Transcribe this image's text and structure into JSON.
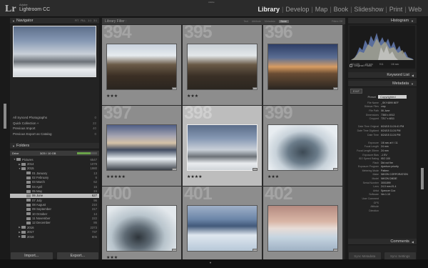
{
  "topbar": {
    "adobe": "Adobe",
    "app_title": "Lightroom CC",
    "logo": "Lr",
    "top_label": "Adobe",
    "modules": [
      "Library",
      "Develop",
      "Map",
      "Book",
      "Slideshow",
      "Print",
      "Web"
    ],
    "active_module": "Library"
  },
  "navigator": {
    "title": "Navigator",
    "options": [
      "FIT",
      "FILL",
      "1:1",
      "3:1"
    ]
  },
  "catalog": [
    {
      "label": "All Synced Photographs",
      "count": "0"
    },
    {
      "label": "Quick Collection +",
      "count": "22"
    },
    {
      "label": "Previous Import",
      "count": "40"
    },
    {
      "label": "Previous Export as Catalog",
      "count": "0"
    }
  ],
  "folders": {
    "title": "Folders",
    "volume": "Drive",
    "volume_info": "3/25 / 10 GB",
    "tree": [
      {
        "name": "Pictures",
        "count": "6547",
        "level": 1,
        "arrow": "▼"
      },
      {
        "name": "2014",
        "count": "1079",
        "level": 2,
        "arrow": "▶"
      },
      {
        "name": "2015",
        "count": "1980",
        "level": 2,
        "arrow": "▼"
      },
      {
        "name": "01 January",
        "count": "13",
        "level": 3,
        "arrow": ""
      },
      {
        "name": "02 February",
        "count": "6",
        "level": 3,
        "arrow": ""
      },
      {
        "name": "03 March",
        "count": "62",
        "level": 3,
        "arrow": ""
      },
      {
        "name": "04 April",
        "count": "15",
        "level": 3,
        "arrow": ""
      },
      {
        "name": "05 May",
        "count": "24",
        "level": 3,
        "arrow": ""
      },
      {
        "name": "06 June",
        "count": "627",
        "level": 3,
        "arrow": "",
        "selected": true
      },
      {
        "name": "07 July",
        "count": "96",
        "level": 3,
        "arrow": ""
      },
      {
        "name": "08 August",
        "count": "210",
        "level": 3,
        "arrow": ""
      },
      {
        "name": "09 September",
        "count": "317",
        "level": 3,
        "arrow": ""
      },
      {
        "name": "10 October",
        "count": "14",
        "level": 3,
        "arrow": ""
      },
      {
        "name": "11 November",
        "count": "222",
        "level": 3,
        "arrow": ""
      },
      {
        "name": "12 December",
        "count": "86",
        "level": 3,
        "arrow": ""
      },
      {
        "name": "2016",
        "count": "2373",
        "level": 2,
        "arrow": "▶"
      },
      {
        "name": "2017",
        "count": "737",
        "level": 2,
        "arrow": "▶"
      },
      {
        "name": "2018",
        "count": "806",
        "level": 2,
        "arrow": "▶"
      }
    ]
  },
  "left_buttons": {
    "import": "Import...",
    "export": "Export..."
  },
  "filter_bar": {
    "title": "Library Filter :",
    "options": [
      "Text",
      "Attribute",
      "Metadata",
      "None"
    ],
    "active": "None",
    "right": "Filters Off"
  },
  "grid": [
    {
      "num": "394",
      "stars": "★★★"
    },
    {
      "num": "395",
      "stars": "★★★"
    },
    {
      "num": "396",
      "stars": ""
    },
    {
      "num": "397",
      "stars": "★★★★★"
    },
    {
      "num": "398",
      "stars": "★★★★",
      "selected": true
    },
    {
      "num": "399",
      "stars": "★★★"
    },
    {
      "num": "400",
      "stars": "★★★"
    },
    {
      "num": "401",
      "stars": ""
    },
    {
      "num": "402",
      "stars": ""
    }
  ],
  "right": {
    "histogram": "Histogram",
    "iso": "ISO 100",
    "focal": "24 mm",
    "fstop": "f/11",
    "shutter": "1/6 sec",
    "original_photo": "Original Photo",
    "keyword_list": "Keyword List",
    "metadata": "Metadata",
    "meta_mode": "EXIF",
    "preset_label": "Preset",
    "preset_value": "Copyrighted",
    "comments": "Comments",
    "fields": [
      {
        "k": "File Name",
        "v": "_SKY4899.NEF"
      },
      {
        "k": "Sidecar Files",
        "v": "xmp"
      },
      {
        "k": "File Path",
        "v": "06 June"
      },
      {
        "k": "Dimensions",
        "v": "7360 x 4912"
      },
      {
        "k": "Cropped",
        "v": "7217 x 4811"
      },
      {
        "k": "",
        "v": ""
      },
      {
        "k": "Date Time Original",
        "v": "6/24/15 11:24:41 PM"
      },
      {
        "k": "Date Time Digitized",
        "v": "6/24/15 11:24 PM"
      },
      {
        "k": "Date Time",
        "v": "6/24/15 11:24 PM"
      },
      {
        "k": "",
        "v": ""
      },
      {
        "k": "Exposure",
        "v": "1/6 sec at f / 11"
      },
      {
        "k": "Focal Length",
        "v": "24 mm"
      },
      {
        "k": "Focal Length 35mm",
        "v": "24 mm"
      },
      {
        "k": "Exposure Bias",
        "v": "-1 EV"
      },
      {
        "k": "ISO Speed Rating",
        "v": "ISO 100"
      },
      {
        "k": "Flash",
        "v": "Did not fire"
      },
      {
        "k": "Exposure Program",
        "v": "Aperture priority"
      },
      {
        "k": "Metering Mode",
        "v": "Pattern"
      },
      {
        "k": "Make",
        "v": "NIKON CORPORATION"
      },
      {
        "k": "Model",
        "v": "NIKON D800E"
      },
      {
        "k": "Serial Number",
        "v": "3001899"
      },
      {
        "k": "Lens",
        "v": "24.0 mm f/1.4"
      },
      {
        "k": "Artist",
        "v": "Spencer Cox"
      },
      {
        "k": "Software",
        "v": "Ver.1.10"
      },
      {
        "k": "User Comment",
        "v": ""
      },
      {
        "k": "GPS",
        "v": ""
      },
      {
        "k": "Altitude",
        "v": ""
      },
      {
        "k": "Direction",
        "v": ""
      }
    ]
  },
  "right_buttons": {
    "sync": "Sync Metadata",
    "sync_settings": "Sync Settings"
  }
}
